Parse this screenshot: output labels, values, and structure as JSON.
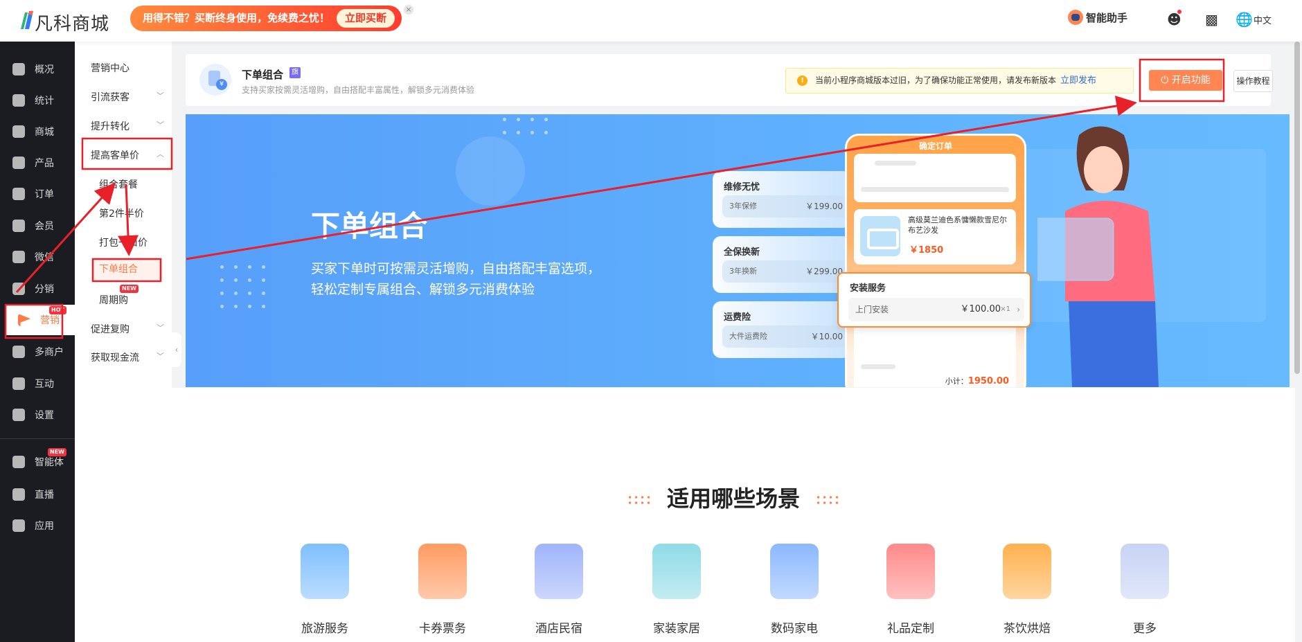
{
  "header": {
    "logo": "凡科商城",
    "promo_text": "用得不错？买断终身使用，免续费之忧！",
    "promo_button": "立即买断",
    "close": "×",
    "assistant": "智能助手",
    "language": "中文"
  },
  "nav": [
    {
      "label": "概况"
    },
    {
      "label": "统计"
    },
    {
      "label": "商城"
    },
    {
      "label": "产品"
    },
    {
      "label": "订单"
    },
    {
      "label": "会员"
    },
    {
      "label": "微信"
    },
    {
      "label": "分销"
    },
    {
      "label": "营销",
      "badge": "HOT",
      "active": true
    },
    {
      "label": "多商户"
    },
    {
      "label": "互动"
    },
    {
      "label": "设置"
    },
    {
      "label": "智能体",
      "badge": "NEW"
    },
    {
      "label": "直播"
    },
    {
      "label": "应用"
    }
  ],
  "submenu": {
    "items": [
      "营销中心",
      "引流获客",
      "提升转化",
      "提高客单价",
      "促进复购",
      "获取现金流"
    ],
    "children": [
      "组合套餐",
      "第2件半价",
      "打包一口价",
      "下单组合",
      "周期购"
    ],
    "new_badge": "NEW",
    "active_child": "下单组合"
  },
  "topcard": {
    "title": "下单组合",
    "badge": "旗",
    "subtitle": "支持买家按需灵活增购，自由搭配丰富属性，解锁多元消费体验",
    "warning": "当前小程序商城版本过旧，为了确保功能正常使用，请发布新版本",
    "warning_link": "立即发布",
    "enable_button": "开启功能",
    "help_button": "操作教程"
  },
  "hero": {
    "title": "下单组合",
    "sub1": "买家下单时可按需灵活增购，自由搭配丰富选项，",
    "sub2": "轻松定制专属组合、解锁多元消费体验",
    "options": [
      {
        "title": "维修无忧",
        "item": "3年保修",
        "price": "￥199.00"
      },
      {
        "title": "全保换新",
        "item": "3年换新",
        "price": "￥299.00"
      },
      {
        "title": "运费险",
        "item": "大件运费险",
        "price": "￥10.00"
      }
    ],
    "phone_title": "确定订单",
    "product_name": "高级莫兰迪色系慵懒款雪尼尔布艺沙发",
    "product_price": "￥1850",
    "install_title": "安装服务",
    "install_item": "上门安装",
    "install_price": "￥100.00",
    "install_qty": "×1",
    "subtotal_label": "小计：",
    "subtotal": "1950.00"
  },
  "scenarios": {
    "title": "适用哪些场景",
    "items": [
      {
        "label": "旅游服务",
        "color": "#7fbfff"
      },
      {
        "label": "卡券票务",
        "color": "#ff9b62"
      },
      {
        "label": "酒店民宿",
        "color": "#9fb4fb"
      },
      {
        "label": "家装家居",
        "color": "#8fdbe6"
      },
      {
        "label": "数码家电",
        "color": "#8cb8ff"
      },
      {
        "label": "礼品定制",
        "color": "#ff8a8a"
      },
      {
        "label": "茶饮烘焙",
        "color": "#ffb14f"
      },
      {
        "label": "更多",
        "color": "#c7d3f5"
      }
    ]
  }
}
